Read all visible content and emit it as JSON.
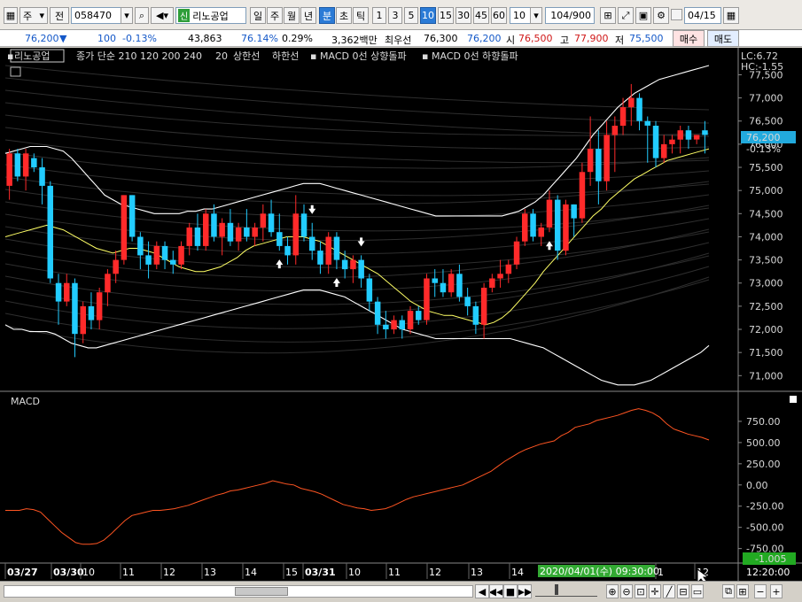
{
  "toolbar": {
    "market": "주",
    "period_type": "전",
    "stock_code": "058470",
    "credit_badge": "신",
    "stock_name": "리노공업",
    "intervals": [
      "일",
      "주",
      "월",
      "년",
      "분",
      "초",
      "틱"
    ],
    "selected_interval": "분",
    "minute_options": [
      "1",
      "3",
      "5",
      "10",
      "15",
      "30",
      "45",
      "60"
    ],
    "selected_minute": "10",
    "count_value": "10",
    "page_counter": "104/900",
    "date_value": "04/15"
  },
  "quote": {
    "price": "76,200",
    "direction_icon": "▼",
    "change": "100",
    "change_pct": "-0.13%",
    "volume": "43,863",
    "volume_ratio": "76.14%",
    "turnover": "0.29%",
    "trade_value": "3,362백만",
    "best_bid_label": "최우선",
    "best_ask": "76,300",
    "best_bid": "76,200",
    "open_label": "시",
    "open": "76,500",
    "high_label": "고",
    "high": "77,900",
    "low_label": "저",
    "low": "75,500",
    "buy_button": "매수",
    "sell_button": "매도"
  },
  "legend": {
    "stock_tag": "리노공업",
    "faded_text": "종가 단순 210 120 200 240",
    "ma_label": "20",
    "upper_label": "상한선",
    "lower_label": "하한선",
    "macd_up_label": "MACD 0선 상향돌파",
    "macd_down_label": "MACD 0선 하향돌파",
    "lc": "LC:6.72",
    "hc": "HC:-1.55",
    "price_tag": "76,200",
    "price_tag_pct": "-0.13%",
    "macd_title": "MACD",
    "macd_value_tag": "-1.005",
    "crosshair_time": "2020/04/01(수) 09:30:00",
    "clock": "12:20:00"
  },
  "price_axis": [
    "77,500",
    "77,000",
    "76,500",
    "76,000",
    "75,500",
    "75,000",
    "74,500",
    "74,000",
    "73,500",
    "73,000",
    "72,500",
    "72,000",
    "71,500",
    "71,000"
  ],
  "macd_axis": [
    "750.00",
    "500.00",
    "250.00",
    "0.00",
    "-250.00",
    "-500.00",
    "-750.00"
  ],
  "time_axis": [
    "03/27",
    "03/30",
    "10",
    "11",
    "12",
    "13",
    "14",
    "15",
    "03/31",
    "10",
    "11",
    "12",
    "13",
    "14",
    "1",
    "12"
  ],
  "colors": {
    "up": "#ff2a2a",
    "down": "#22ccff",
    "ma": "#ffff66",
    "band": "#ffffff",
    "macd": "#ff5522",
    "label_red": "#ff4444"
  },
  "chart_data": {
    "type": "candlestick",
    "x_unit": "10-minute bars, 2020/03/27 to 2020/04/01",
    "ylim": [
      70700,
      77700
    ],
    "candles": [
      {
        "o": 75100,
        "h": 75900,
        "l": 74800,
        "c": 75800
      },
      {
        "o": 75800,
        "h": 75900,
        "l": 75200,
        "c": 75300
      },
      {
        "o": 75300,
        "h": 75900,
        "l": 75000,
        "c": 75800
      },
      {
        "o": 75700,
        "h": 75800,
        "l": 75400,
        "c": 75500
      },
      {
        "o": 75500,
        "h": 75700,
        "l": 74700,
        "c": 75100
      },
      {
        "o": 75100,
        "h": 75200,
        "l": 73000,
        "c": 73100
      },
      {
        "o": 73000,
        "h": 73200,
        "l": 72100,
        "c": 72600
      },
      {
        "o": 72600,
        "h": 73200,
        "l": 72500,
        "c": 73000
      },
      {
        "o": 73000,
        "h": 73100,
        "l": 71400,
        "c": 71900
      },
      {
        "o": 71900,
        "h": 72600,
        "l": 71700,
        "c": 72500
      },
      {
        "o": 72500,
        "h": 72800,
        "l": 72000,
        "c": 72200
      },
      {
        "o": 72200,
        "h": 72900,
        "l": 72000,
        "c": 72800
      },
      {
        "o": 72800,
        "h": 73300,
        "l": 72500,
        "c": 73200
      },
      {
        "o": 73200,
        "h": 73700,
        "l": 73000,
        "c": 73500
      },
      {
        "o": 73500,
        "h": 74900,
        "l": 73400,
        "c": 74900
      },
      {
        "o": 74900,
        "h": 74900,
        "l": 73900,
        "c": 74000
      },
      {
        "o": 74000,
        "h": 74100,
        "l": 73300,
        "c": 73600
      },
      {
        "o": 73600,
        "h": 73900,
        "l": 73100,
        "c": 73400
      },
      {
        "o": 73400,
        "h": 73900,
        "l": 73300,
        "c": 73800
      },
      {
        "o": 73800,
        "h": 73900,
        "l": 73300,
        "c": 73500
      },
      {
        "o": 73500,
        "h": 73700,
        "l": 73200,
        "c": 73400
      },
      {
        "o": 73400,
        "h": 73900,
        "l": 73300,
        "c": 73800
      },
      {
        "o": 73800,
        "h": 74300,
        "l": 73600,
        "c": 74200
      },
      {
        "o": 74200,
        "h": 74500,
        "l": 73700,
        "c": 73800
      },
      {
        "o": 73800,
        "h": 74600,
        "l": 73700,
        "c": 74500
      },
      {
        "o": 74500,
        "h": 74700,
        "l": 73900,
        "c": 74000
      },
      {
        "o": 74000,
        "h": 74400,
        "l": 73600,
        "c": 74300
      },
      {
        "o": 74300,
        "h": 74600,
        "l": 73800,
        "c": 73900
      },
      {
        "o": 73900,
        "h": 74300,
        "l": 73700,
        "c": 74200
      },
      {
        "o": 74200,
        "h": 74600,
        "l": 73900,
        "c": 74000
      },
      {
        "o": 74000,
        "h": 74300,
        "l": 73800,
        "c": 74200
      },
      {
        "o": 74200,
        "h": 74700,
        "l": 73900,
        "c": 74500
      },
      {
        "o": 74500,
        "h": 74800,
        "l": 74000,
        "c": 74100
      },
      {
        "o": 74100,
        "h": 74500,
        "l": 73700,
        "c": 73800
      },
      {
        "o": 73800,
        "h": 74000,
        "l": 73400,
        "c": 73600
      },
      {
        "o": 73600,
        "h": 74900,
        "l": 73400,
        "c": 74500
      },
      {
        "o": 74500,
        "h": 74700,
        "l": 73900,
        "c": 74000
      },
      {
        "o": 74000,
        "h": 74300,
        "l": 73500,
        "c": 73700
      },
      {
        "o": 73700,
        "h": 73900,
        "l": 73200,
        "c": 73400
      },
      {
        "o": 73400,
        "h": 74100,
        "l": 73200,
        "c": 74000
      },
      {
        "o": 74000,
        "h": 74100,
        "l": 73300,
        "c": 73500
      },
      {
        "o": 73500,
        "h": 73700,
        "l": 73100,
        "c": 73300
      },
      {
        "o": 73300,
        "h": 73600,
        "l": 73000,
        "c": 73500
      },
      {
        "o": 73500,
        "h": 73600,
        "l": 72900,
        "c": 73100
      },
      {
        "o": 73100,
        "h": 73200,
        "l": 72400,
        "c": 72600
      },
      {
        "o": 72600,
        "h": 72700,
        "l": 71900,
        "c": 72100
      },
      {
        "o": 72100,
        "h": 72400,
        "l": 71800,
        "c": 72000
      },
      {
        "o": 72000,
        "h": 72300,
        "l": 71900,
        "c": 72200
      },
      {
        "o": 72200,
        "h": 72300,
        "l": 71800,
        "c": 72000
      },
      {
        "o": 72000,
        "h": 72500,
        "l": 71900,
        "c": 72400
      },
      {
        "o": 72400,
        "h": 72500,
        "l": 72100,
        "c": 72200
      },
      {
        "o": 72200,
        "h": 73200,
        "l": 72100,
        "c": 73100
      },
      {
        "o": 73100,
        "h": 73300,
        "l": 72700,
        "c": 73000
      },
      {
        "o": 73000,
        "h": 73300,
        "l": 72700,
        "c": 72800
      },
      {
        "o": 72800,
        "h": 73300,
        "l": 72700,
        "c": 73200
      },
      {
        "o": 73200,
        "h": 73400,
        "l": 72600,
        "c": 72700
      },
      {
        "o": 72700,
        "h": 72900,
        "l": 72300,
        "c": 72500
      },
      {
        "o": 72500,
        "h": 72600,
        "l": 71900,
        "c": 72100
      },
      {
        "o": 72100,
        "h": 73000,
        "l": 71800,
        "c": 72900
      },
      {
        "o": 72900,
        "h": 73200,
        "l": 72800,
        "c": 73100
      },
      {
        "o": 73100,
        "h": 73500,
        "l": 72900,
        "c": 73200
      },
      {
        "o": 73200,
        "h": 73500,
        "l": 73000,
        "c": 73400
      },
      {
        "o": 73400,
        "h": 74000,
        "l": 73300,
        "c": 73900
      },
      {
        "o": 73900,
        "h": 74600,
        "l": 73800,
        "c": 74500
      },
      {
        "o": 74500,
        "h": 74600,
        "l": 73900,
        "c": 74000
      },
      {
        "o": 74000,
        "h": 74300,
        "l": 73800,
        "c": 74200
      },
      {
        "o": 74200,
        "h": 75000,
        "l": 74100,
        "c": 74800
      },
      {
        "o": 74800,
        "h": 74900,
        "l": 73500,
        "c": 73700
      },
      {
        "o": 73700,
        "h": 74800,
        "l": 73600,
        "c": 74700
      },
      {
        "o": 74700,
        "h": 74700,
        "l": 74000,
        "c": 74400
      },
      {
        "o": 74400,
        "h": 75600,
        "l": 74300,
        "c": 75400
      },
      {
        "o": 75400,
        "h": 76600,
        "l": 75100,
        "c": 75900
      },
      {
        "o": 75900,
        "h": 76300,
        "l": 74700,
        "c": 75200
      },
      {
        "o": 75200,
        "h": 76500,
        "l": 75000,
        "c": 76200
      },
      {
        "o": 76200,
        "h": 76600,
        "l": 75400,
        "c": 76400
      },
      {
        "o": 76400,
        "h": 77000,
        "l": 76200,
        "c": 76800
      },
      {
        "o": 76800,
        "h": 77300,
        "l": 76400,
        "c": 77000
      },
      {
        "o": 77000,
        "h": 77100,
        "l": 76300,
        "c": 76500
      },
      {
        "o": 76500,
        "h": 76600,
        "l": 75600,
        "c": 76400
      },
      {
        "o": 76400,
        "h": 76500,
        "l": 75500,
        "c": 75700
      },
      {
        "o": 75700,
        "h": 76200,
        "l": 75600,
        "c": 76000
      },
      {
        "o": 76000,
        "h": 76200,
        "l": 75800,
        "c": 76100
      },
      {
        "o": 76100,
        "h": 76400,
        "l": 75800,
        "c": 76300
      },
      {
        "o": 76300,
        "h": 76400,
        "l": 75900,
        "c": 76100
      },
      {
        "o": 76100,
        "h": 76200,
        "l": 76000,
        "c": 76200
      },
      {
        "o": 76300,
        "h": 76500,
        "l": 75800,
        "c": 76200
      }
    ],
    "ma20": [
      74000,
      74050,
      74100,
      74150,
      74200,
      74250,
      74200,
      74150,
      74050,
      73950,
      73850,
      73750,
      73700,
      73650,
      73700,
      73750,
      73750,
      73700,
      73650,
      73550,
      73450,
      73350,
      73300,
      73250,
      73250,
      73300,
      73350,
      73450,
      73550,
      73700,
      73800,
      73850,
      73900,
      73950,
      74000,
      74000,
      74000,
      73950,
      73900,
      73800,
      73700,
      73600,
      73500,
      73400,
      73300,
      73200,
      73050,
      72900,
      72750,
      72600,
      72500,
      72400,
      72350,
      72300,
      72300,
      72250,
      72200,
      72150,
      72100,
      72150,
      72250,
      72400,
      72600,
      72800,
      73000,
      73250,
      73450,
      73650,
      73850,
      74050,
      74250,
      74450,
      74600,
      74800,
      74950,
      75100,
      75250,
      75350,
      75450,
      75550,
      75650,
      75700,
      75750,
      75800,
      75850,
      75900
    ],
    "upper_band": [
      75800,
      75850,
      75900,
      75950,
      75950,
      75950,
      75900,
      75850,
      75700,
      75500,
      75300,
      75100,
      74900,
      74800,
      74700,
      74650,
      74600,
      74550,
      74500,
      74500,
      74500,
      74500,
      74550,
      74550,
      74600,
      74600,
      74650,
      74700,
      74750,
      74800,
      74850,
      74900,
      74950,
      75000,
      75050,
      75100,
      75150,
      75150,
      75150,
      75100,
      75050,
      75000,
      74950,
      74900,
      74850,
      74800,
      74750,
      74700,
      74650,
      74600,
      74550,
      74500,
      74450,
      74450,
      74450,
      74450,
      74450,
      74450,
      74450,
      74450,
      74450,
      74500,
      74550,
      74650,
      74750,
      74900,
      75100,
      75300,
      75500,
      75700,
      75950,
      76200,
      76400,
      76600,
      76800,
      76950,
      77100,
      77200,
      77300,
      77400,
      77450,
      77500,
      77550,
      77600,
      77650,
      77700
    ],
    "lower_band": [
      72100,
      72000,
      72000,
      71950,
      71950,
      71950,
      71900,
      71800,
      71700,
      71650,
      71600,
      71600,
      71650,
      71700,
      71750,
      71800,
      71850,
      71900,
      71950,
      72000,
      72050,
      72100,
      72150,
      72200,
      72250,
      72300,
      72350,
      72400,
      72450,
      72500,
      72550,
      72600,
      72650,
      72700,
      72750,
      72800,
      72850,
      72850,
      72850,
      72800,
      72750,
      72700,
      72600,
      72500,
      72400,
      72300,
      72200,
      72100,
      72000,
      71950,
      71900,
      71850,
      71800,
      71800,
      71800,
      71800,
      71800,
      71800,
      71800,
      71800,
      71800,
      71800,
      71750,
      71700,
      71650,
      71600,
      71500,
      71400,
      71300,
      71200,
      71100,
      71000,
      70900,
      70850,
      70800,
      70800,
      70800,
      70850,
      70900,
      71000,
      71100,
      71200,
      71300,
      71400,
      71500,
      71650
    ],
    "macd": [
      -300,
      -300,
      -300,
      -280,
      -290,
      -320,
      -400,
      -480,
      -560,
      -620,
      -680,
      -700,
      -700,
      -690,
      -650,
      -580,
      -500,
      -420,
      -360,
      -340,
      -320,
      -300,
      -300,
      -290,
      -280,
      -260,
      -240,
      -210,
      -180,
      -150,
      -120,
      -100,
      -70,
      -60,
      -40,
      -20,
      0,
      20,
      50,
      30,
      10,
      0,
      -40,
      -60,
      -80,
      -110,
      -150,
      -190,
      -230,
      -250,
      -270,
      -280,
      -300,
      -290,
      -280,
      -250,
      -210,
      -170,
      -140,
      -120,
      -100,
      -80,
      -60,
      -40,
      -20,
      0,
      40,
      80,
      120,
      160,
      220,
      280,
      330,
      380,
      420,
      450,
      480,
      500,
      520,
      580,
      620,
      680,
      700,
      720,
      760,
      780,
      800,
      820,
      850,
      880,
      900,
      880,
      850,
      800,
      720,
      660,
      630,
      600,
      580,
      560,
      530
    ]
  }
}
